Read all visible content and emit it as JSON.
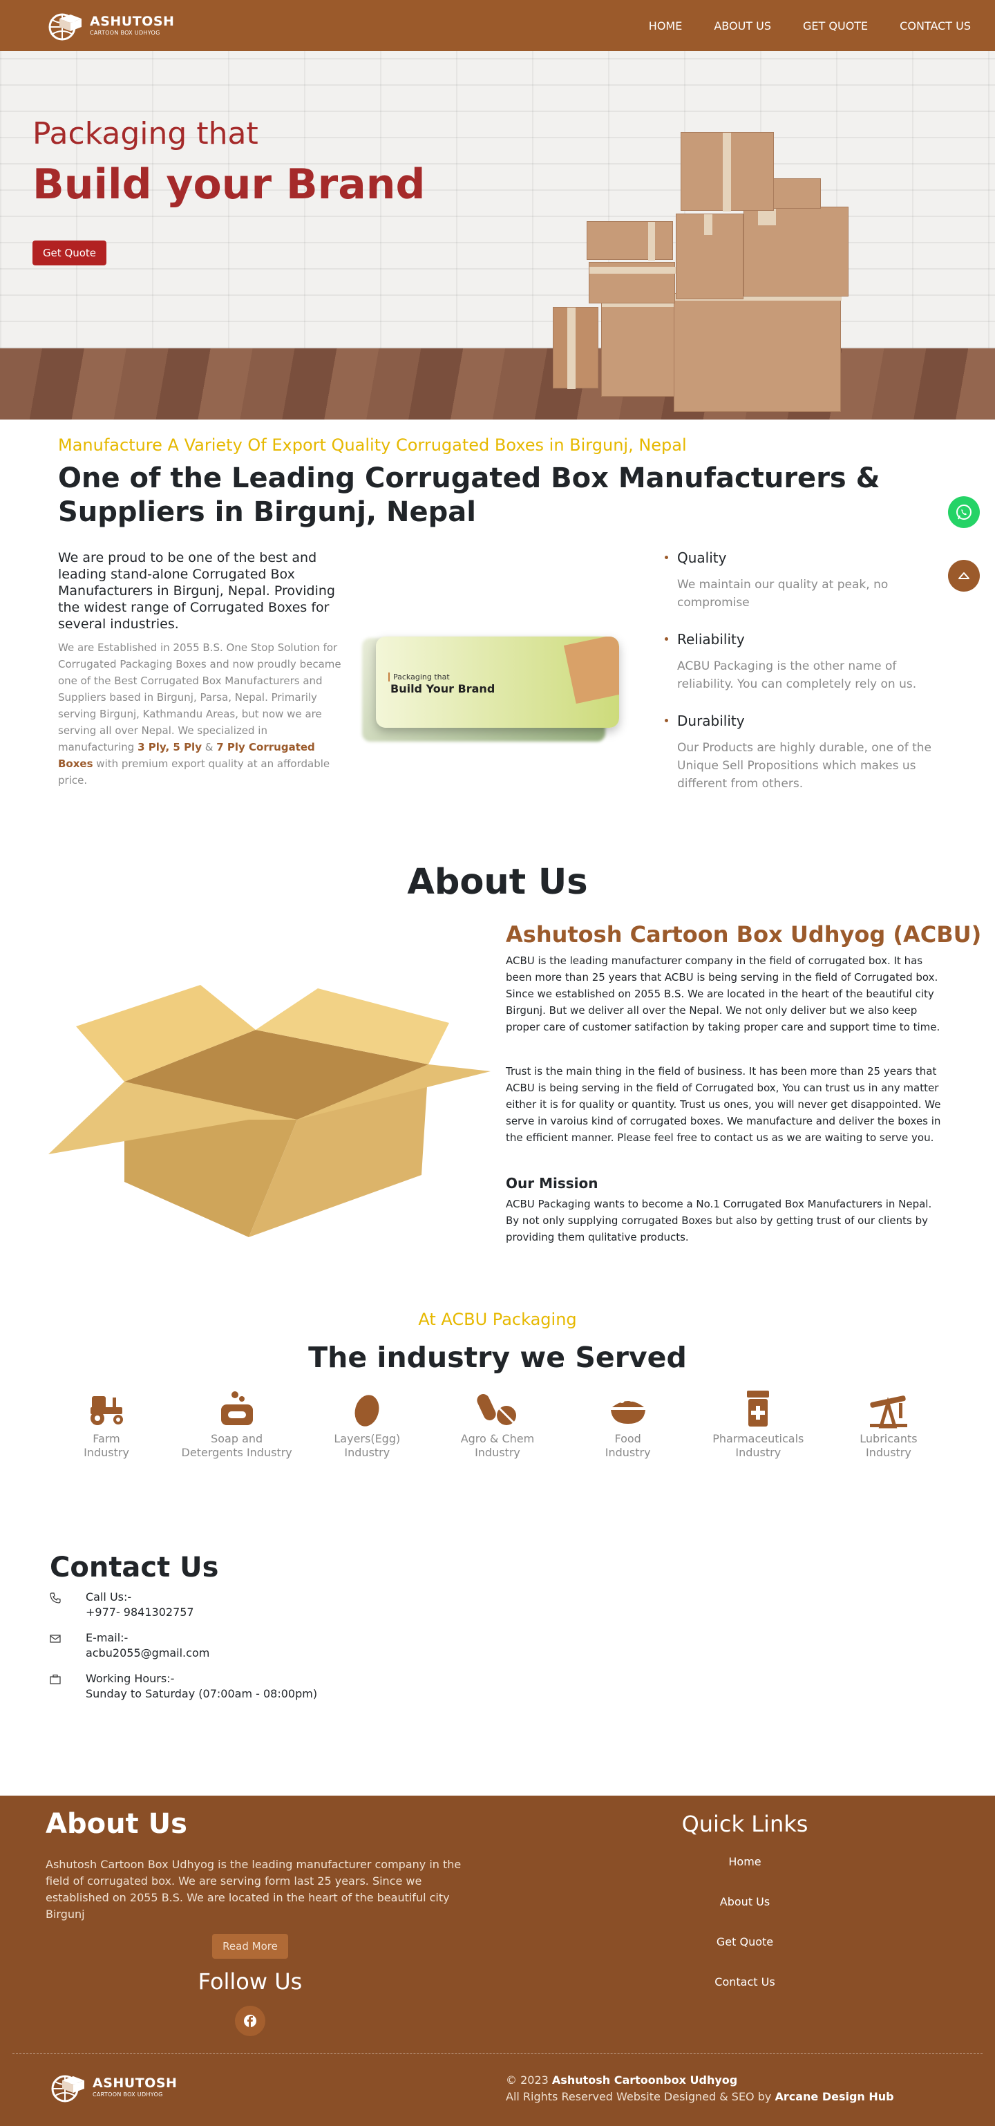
{
  "brand": {
    "name": "ASHUTOSH",
    "tagline": "CARTOON BOX UDHYOG"
  },
  "nav": {
    "items": [
      "HOME",
      "ABOUT US",
      "GET QUOTE",
      "CONTACT US"
    ]
  },
  "hero": {
    "subtitle": "Packaging that",
    "title": "Build your Brand",
    "cta": "Get Quote"
  },
  "intro": {
    "tag": "Manufacture A Variety Of Export Quality Corrugated Boxes in Birgunj, Nepal",
    "title": "One of the Leading Corrugated Box Manufacturers & Suppliers in Birgunj, Nepal",
    "lead": "We are proud to be one of the best and leading stand-alone Corrugated Box Manufacturers in Birgunj, Nepal. Providing the widest range of Corrugated Boxes for several industries.",
    "body_prefix": "We are Established in 2055 B.S. One Stop Solution for Corrugated Packaging Boxes and now proudly became one of the Best Corrugated Box Manufacturers and Suppliers based in Birgunj, Parsa, Nepal. Primarily serving Birgunj, Kathmandu Areas, but now we are serving all over Nepal. We specialized in manufacturing",
    "ply_1": "3 Ply, 5 Ply",
    "amp": "&",
    "ply_2": "7 Ply Corrugated Boxes",
    "body_suffix": "with premium export quality at an affordable price.",
    "banner_small": "Packaging that",
    "banner_big": "Build Your Brand",
    "features": [
      {
        "title": "Quality",
        "text": "We maintain our quality at peak, no compromise"
      },
      {
        "title": "Reliability",
        "text": "ACBU Packaging is the other name of reliability. You can completely rely on us."
      },
      {
        "title": "Durability",
        "text": "Our Products are highly durable, one of the Unique Sell Propositions which makes us different from others."
      }
    ]
  },
  "about": {
    "heading": "About Us",
    "subheading": "Ashutosh Cartoon Box Udhyog (ACBU)",
    "p1": "ACBU is the leading manufacturer company in the field of corrugated box. It has been more than 25 years that ACBU is being serving in the field of Corrugated box. Since we established on 2055 B.S. We are located in the heart of the beautiful city Birgunj. But we deliver all over the Nepal. We not only deliver but we also keep proper care of customer satifaction by taking proper care and support time to time.",
    "p2": "Trust is the main thing in the field of business. It has been more than 25 years that ACBU is being serving in the field of Corrugated box, You can trust us in any matter either it is for quality or quantity. Trust us ones, you will never get disappointed. We serve in varoius kind of corrugated boxes. We manufacture and deliver the boxes in the efficient manner. Please feel free to contact us as we are waiting to serve you.",
    "mission_title": "Our Mission",
    "mission": "ACBU Packaging wants to become a No.1 Corrugated Box Manufacturers in Nepal. By not only supplying corrugated Boxes but also by getting trust of our clients by providing them qulitative products."
  },
  "industry": {
    "tag": "At ACBU Packaging",
    "title": "The industry we Served",
    "items": [
      {
        "line1": "Farm",
        "line2": "Industry",
        "icon": "tractor-icon"
      },
      {
        "line1": "Soap and",
        "line2": "Detergents Industry",
        "icon": "soap-icon"
      },
      {
        "line1": "Layers(Egg)",
        "line2": "Industry",
        "icon": "egg-icon"
      },
      {
        "line1": "Agro & Chem",
        "line2": "Industry",
        "icon": "pills-icon"
      },
      {
        "line1": "Food",
        "line2": "Industry",
        "icon": "bowl-icon"
      },
      {
        "line1": "Pharmaceuticals",
        "line2": "Industry",
        "icon": "prescription-bottle-icon"
      },
      {
        "line1": "Lubricants",
        "line2": "Industry",
        "icon": "oil-pump-icon"
      }
    ]
  },
  "contact": {
    "heading": "Contact Us",
    "call_label": "Call Us:-",
    "call_value": "+977- 9841302757",
    "email_label": "E-mail:-",
    "email_value": "acbu2055@gmail.com",
    "hours_label": "Working Hours:-",
    "hours_value": "Sunday to Saturday (07:00am - 08:00pm)"
  },
  "footer": {
    "about_heading": "About Us",
    "about_text": "Ashutosh Cartoon Box Udhyog is the leading manufacturer company in the field of corrugated box. We are serving form last 25 years. Since we established on 2055 B.S. We are located in the heart of the beautiful city Birgunj",
    "read_more": "Read More",
    "follow": "Follow Us",
    "quick_links_heading": "Quick Links",
    "links": [
      "Home",
      "About Us",
      "Get Quote",
      "Contact Us"
    ],
    "copyright_prefix": "© 2023",
    "company": "Ashutosh Cartoonbox Udhyog",
    "rights_prefix": "All Rights Reserved Website Designed & SEO by",
    "designer": "Arcane Design Hub"
  },
  "colors": {
    "brand_brown": "#9b5a2b",
    "footer_brown": "#8a4f27",
    "hero_red": "#a52a2a",
    "accent_yellow": "#e6b800",
    "whatsapp_green": "#25d366"
  }
}
